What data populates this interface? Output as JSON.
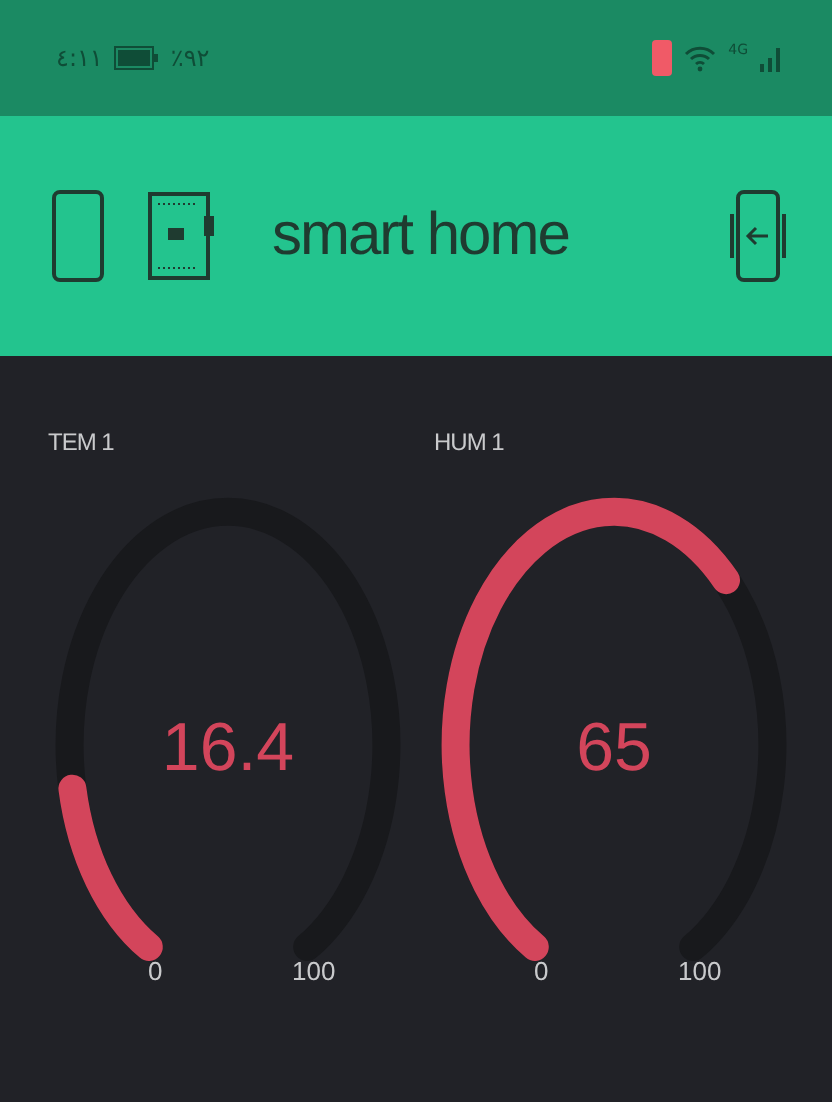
{
  "status_bar": {
    "time": "٤:١١",
    "battery": "٪٩٢",
    "network": "4G"
  },
  "header": {
    "title": "smart home"
  },
  "gauges": [
    {
      "label": "TEM 1",
      "value": "16.4",
      "min": "0",
      "max": "100"
    },
    {
      "label": "HUM 1",
      "value": "65",
      "min": "0",
      "max": "100"
    }
  ]
}
